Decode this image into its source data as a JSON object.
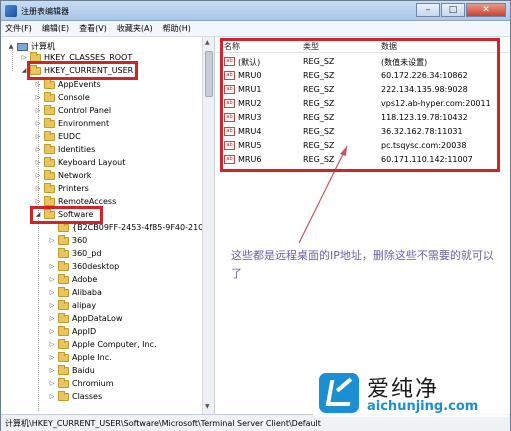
{
  "window": {
    "title": "注册表编辑器",
    "minimize": "–",
    "maximize": "□",
    "close": "✕"
  },
  "menu": [
    "文件(F)",
    "编辑(E)",
    "查看(V)",
    "收藏夹(A)",
    "帮助(H)"
  ],
  "tree": {
    "root": "计算机",
    "hkcr": "HKEY_CLASSES_ROOT",
    "hkcu": "HKEY_CURRENT_USER",
    "hkcu_children": [
      "AppEvents",
      "Console",
      "Control Panel",
      "Environment",
      "EUDC",
      "Identities",
      "Keyboard Layout",
      "Network",
      "Printers",
      "RemoteAccess"
    ],
    "software": "Software",
    "software_children": [
      "{B2CB09FF-2453-4f85-9F40-21C05E",
      "360",
      "360_pd",
      "360desktop",
      "Adobe",
      "Alibaba",
      "alipay",
      "AppDataLow",
      "AppID",
      "Apple Computer, Inc.",
      "Apple Inc.",
      "Baidu",
      "Chromium",
      "Classes"
    ]
  },
  "values_pane": {
    "headers": {
      "name": "名称",
      "type": "类型",
      "data": "数据"
    },
    "rows": [
      {
        "name": "(默认)",
        "type": "REG_SZ",
        "data": "(数值未设置)"
      },
      {
        "name": "MRU0",
        "type": "REG_SZ",
        "data": "60.172.226.34:10862"
      },
      {
        "name": "MRU1",
        "type": "REG_SZ",
        "data": "222.134.135.98:9028"
      },
      {
        "name": "MRU2",
        "type": "REG_SZ",
        "data": "vps12.ab-hyper.com:20011"
      },
      {
        "name": "MRU3",
        "type": "REG_SZ",
        "data": "118.123.19.78:10432"
      },
      {
        "name": "MRU4",
        "type": "REG_SZ",
        "data": "36.32.162.78:11031"
      },
      {
        "name": "MRU5",
        "type": "REG_SZ",
        "data": "pc.tsqysc.com:20038"
      },
      {
        "name": "MRU6",
        "type": "REG_SZ",
        "data": "60.171.110.142:11007"
      }
    ],
    "ab_icon": "ab"
  },
  "annotation": "这些都是远程桌面的IP地址，删除这些不需要的就可以了",
  "statusbar": "计算机\\HKEY_CURRENT_USER\\Software\\Microsoft\\Terminal Server Client\\Default",
  "watermark": {
    "name": "爱纯净",
    "url": "aichunjing.com"
  },
  "colors": {
    "highlight": "#d2232a",
    "annotation": "#6c5fa9",
    "brand": "#1a8fd1"
  }
}
